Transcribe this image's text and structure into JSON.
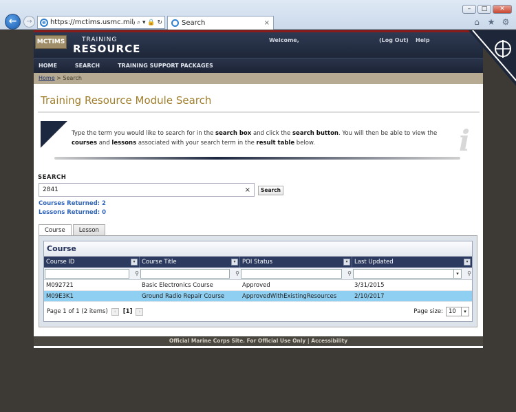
{
  "browser": {
    "url": "https://mctims.usmc.mil/Curricul",
    "url_tools": "⌕ ▾ 🔒 ↻",
    "tab_title": "Search",
    "tab_close": "×",
    "win_min": "–",
    "win_max": "□",
    "win_close": "✕",
    "back": "←",
    "forward": "→",
    "home_icon": "⌂",
    "fav_icon": "★",
    "tools_icon": "⚙"
  },
  "header": {
    "logo_mctims": "MCTIMS",
    "logo_training": "TRAINING",
    "logo_resource": "RESOURCE",
    "welcome": "Welcome,",
    "logout": "(Log Out)",
    "help": "Help"
  },
  "nav": {
    "home": "HOME",
    "search": "SEARCH",
    "tsp": "TRAINING SUPPORT PACKAGES"
  },
  "breadcrumb": {
    "home": "Home",
    "sep": " > ",
    "current": "Search"
  },
  "page_title": "Training Resource Module Search",
  "info": {
    "t1": "Type the term you would like to search for in the ",
    "b1": "search box",
    "t2": " and click the ",
    "b2": "search button",
    "t3": ". You will then be able to view the ",
    "b3": "courses",
    "t4": " and ",
    "b4": "lessons",
    "t5": " associated with your search term in the ",
    "b5": "result table",
    "t6": " below.",
    "icon_glyph": "i"
  },
  "search": {
    "label": "SEARCH",
    "value": "2841",
    "clear": "×",
    "button": "Search",
    "courses_returned": "Courses Returned: 2",
    "lessons_returned": "Lessons Returned: 0"
  },
  "tabs": [
    "Course",
    "Lesson"
  ],
  "grid": {
    "title": "Course",
    "columns": [
      "Course ID",
      "Course Title",
      "POI Status",
      "Last Updated"
    ],
    "rows": [
      [
        "M092721",
        "Basic Electronics Course",
        "Approved",
        "3/31/2015"
      ],
      [
        "M09E3K1",
        "Ground Radio Repair Course",
        "ApprovedWithExistingResources",
        "2/10/2017"
      ]
    ],
    "pager_text": "Page 1 of 1 (2 items)",
    "pager_current": "[1]",
    "page_size_label": "Page size:",
    "page_size": "10"
  },
  "footer": "Official Marine Corps Site. For Official Use Only | Accessibility"
}
